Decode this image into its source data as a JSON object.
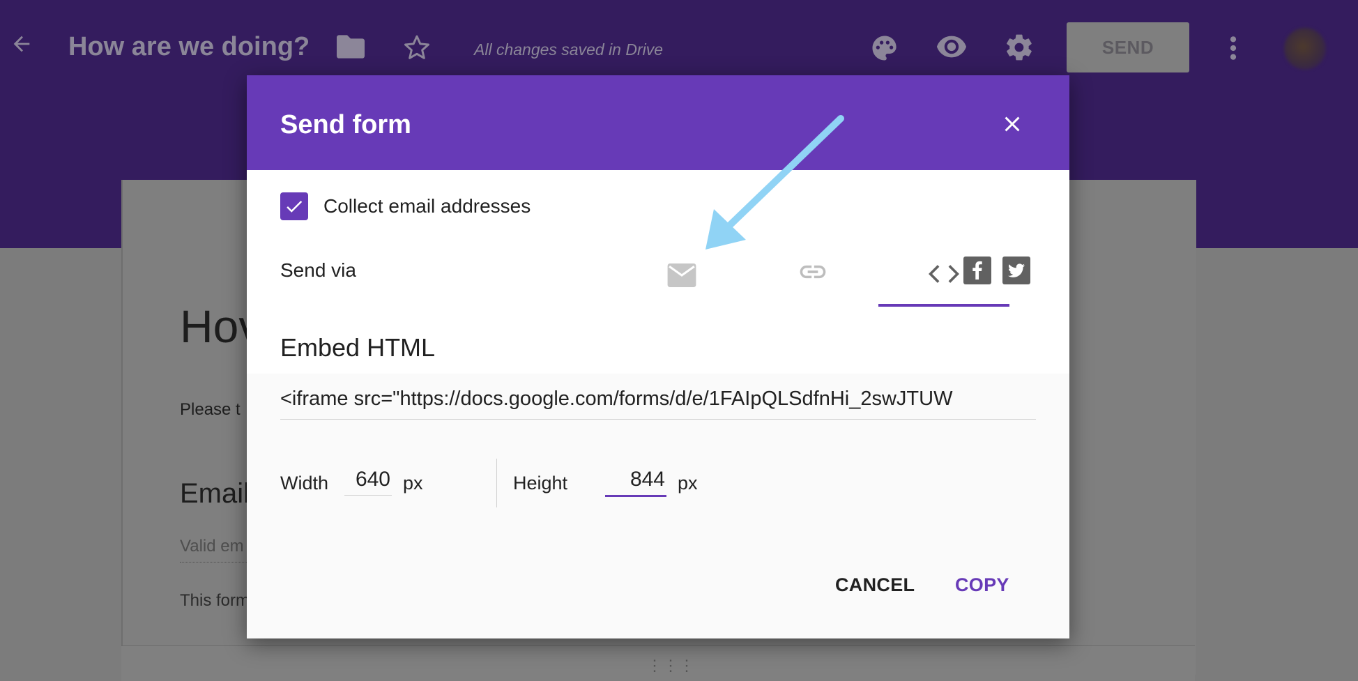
{
  "app": {
    "form_title": "How are we doing?",
    "save_status": "All changes saved in Drive",
    "send_label": "SEND"
  },
  "background_form": {
    "title_fragment": "Hov",
    "description_fragment": "Please t",
    "question_fragment": "Email",
    "placeholder_fragment": "Valid em",
    "note_fragment": "This form",
    "drag_handle": "⋮⋮⋮"
  },
  "dialog": {
    "title": "Send form",
    "collect_email_label": "Collect email addresses",
    "collect_email_checked": true,
    "send_via_label": "Send via",
    "tabs": [
      {
        "icon": "email-icon",
        "selected": false
      },
      {
        "icon": "link-icon",
        "selected": false
      },
      {
        "icon": "embed-code-icon",
        "selected": true
      }
    ],
    "embed_heading": "Embed HTML",
    "embed_code": "<iframe src=\"https://docs.google.com/forms/d/e/1FAIpQLSdfnHi_2swJTUW",
    "width_label": "Width",
    "width_value": "640",
    "height_label": "Height",
    "height_value": "844",
    "unit": "px",
    "cancel_label": "CANCEL",
    "copy_label": "COPY"
  },
  "colors": {
    "accent": "#673ab7",
    "header_dimmed": "#341c5e",
    "annotation_arrow": "#90d3f5"
  }
}
